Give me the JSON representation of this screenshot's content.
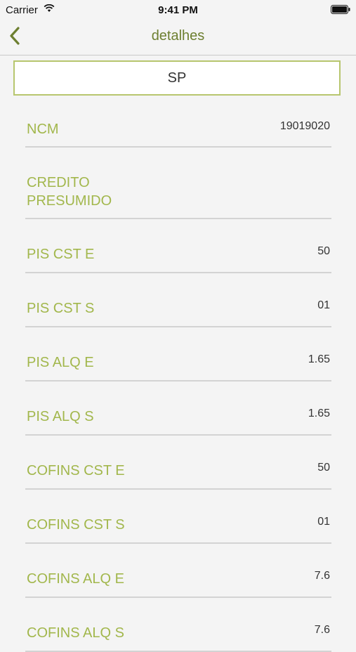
{
  "status": {
    "carrier": "Carrier",
    "time": "9:41 PM"
  },
  "nav": {
    "title": "detalhes"
  },
  "region": {
    "value": "SP"
  },
  "rows": [
    {
      "label": "NCM",
      "value": "19019020"
    },
    {
      "label": "CREDITO\nPRESUMIDO",
      "value": ""
    },
    {
      "label": "PIS CST E",
      "value": "50"
    },
    {
      "label": "PIS CST S",
      "value": "01"
    },
    {
      "label": "PIS ALQ E",
      "value": "1.65"
    },
    {
      "label": "PIS ALQ S",
      "value": "1.65"
    },
    {
      "label": "COFINS CST E",
      "value": "50"
    },
    {
      "label": "COFINS CST S",
      "value": "01"
    },
    {
      "label": "COFINS ALQ E",
      "value": "7.6"
    },
    {
      "label": "COFINS ALQ S",
      "value": "7.6"
    }
  ]
}
